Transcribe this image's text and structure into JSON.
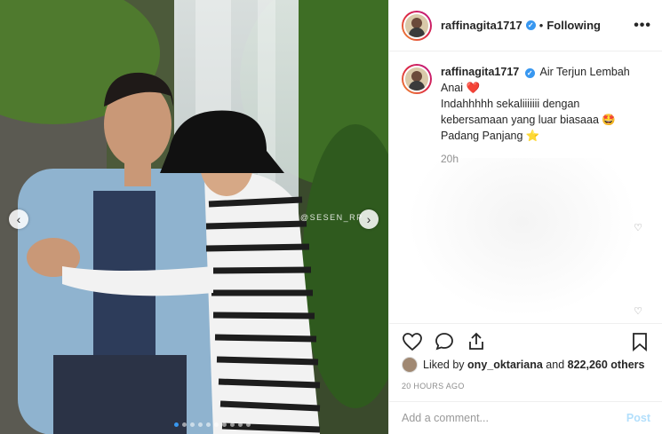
{
  "post": {
    "watermark": "@SESEN_RP",
    "carousel_dots": 10,
    "carousel_active_index": 0
  },
  "header": {
    "username": "raffinagita1717",
    "separator": "•",
    "follow_state": "Following",
    "more_label": "•••"
  },
  "caption": {
    "username": "raffinagita1717",
    "line1": "Air Terjun Lembah",
    "line2": "Anai ❤️",
    "line3": "Indahhhhh sekaliiiiiii dengan",
    "line4": "kebersamaan yang luar biasaaa 🤩",
    "line5": "Padang Panjang ⭐",
    "time": "20h"
  },
  "likes": {
    "prefix": "Liked by",
    "user": "ony_oktariana",
    "middle": "and",
    "others": "822,260 others"
  },
  "timestamp": "20 HOURS AGO",
  "comment": {
    "placeholder": "Add a comment...",
    "post_label": "Post"
  },
  "colors": {
    "accent": "#3897f0",
    "like_heart_outline": "#262626",
    "post_disabled": "#b2dffc"
  }
}
